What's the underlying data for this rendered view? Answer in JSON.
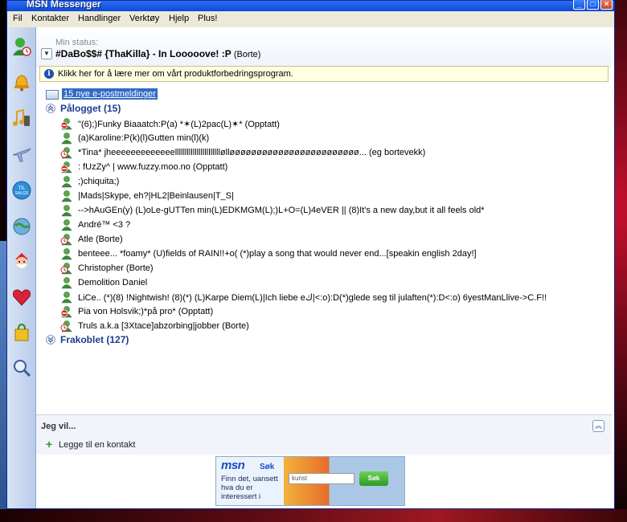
{
  "window": {
    "title": "MSN Messenger"
  },
  "menu": [
    "Fil",
    "Kontakter",
    "Handlinger",
    "Verktøy",
    "Hjelp",
    "Plus!"
  ],
  "status": {
    "label": "Min status:",
    "name": "#DaBo$$# {ThaKilla} - In Looooove! :P",
    "state": "(Borte)"
  },
  "info_bar": {
    "text": "Klikk her for å lære mer om vårt produktforbedringsprogram."
  },
  "email": {
    "label": "15 nye e-postmeldinger"
  },
  "groups": {
    "online": "Pålogget (15)",
    "offline": "Frakoblet (127)"
  },
  "contacts": [
    {
      "name": "\"(6);)Funky Biaaatch:P(a)    *✶(L)2pac(L)✶* (Opptatt)",
      "status": "busy"
    },
    {
      "name": "(a)Karoline:P(k)(l)Gutten min(l)(k)",
      "status": "online"
    },
    {
      "name": "*Tina* jheeeeeeeeeeeeelllllllllllllllllllllllølløøøøøøøøøøøøøøøøøøøøøøøø... (eg bortevekk)",
      "status": "away"
    },
    {
      "name": ": fUzZy^ | www.fuzzy.moo.no (Opptatt)",
      "status": "busy"
    },
    {
      "name": ";)chiquita;)",
      "status": "online"
    },
    {
      "name": "|Mads|Skype, eh?|HL2|Beinlausen|T_S|",
      "status": "online"
    },
    {
      "name": "-->hAuGEn(y)  (L)oLe-gUTTen min(L)EDKMGM(L);)L+O=(L)4eVER    || (8)It's a new day,but it all feels old*",
      "status": "online"
    },
    {
      "name": "André™ <3 ?",
      "status": "online"
    },
    {
      "name": "Atle (Borte)",
      "status": "away"
    },
    {
      "name": "benteee... *foamy*   (U)fields of RAIN!!+o(   (*)play a song that would never end...[speakin english 2day!]",
      "status": "online"
    },
    {
      "name": "Christopher (Borte)",
      "status": "away"
    },
    {
      "name": "Demolition Daniel",
      "status": "online"
    },
    {
      "name": "LiCe.. (*)(8) !Nightwish! (8)(*) (L)Karpe Diem(L)|Ich liebe eك|<:o):D(*)glede seg til julaften(*):D<:o) 6yestManLlive->C.F!!",
      "status": "online"
    },
    {
      "name": "Pia von Holsvik;)*på pro* (Opptatt)",
      "status": "busy"
    },
    {
      "name": "Truls a.k.a  [3Xtace]abzorbing|jobber (Borte)",
      "status": "away"
    }
  ],
  "bottom": {
    "jeg_vil": "Jeg vil...",
    "add_contact": "Legge til en kontakt"
  },
  "ad": {
    "logo": "msn",
    "sok_label": "Søk",
    "tagline": "Finn det, uansett hva du er interessert i",
    "input_text": "kunst",
    "button": "Søk"
  },
  "colors": {
    "window_blue": "#0831d9",
    "group_text": "#1a3d8f",
    "link_highlight": "#316ac5",
    "info_bg": "#ffffe1"
  }
}
